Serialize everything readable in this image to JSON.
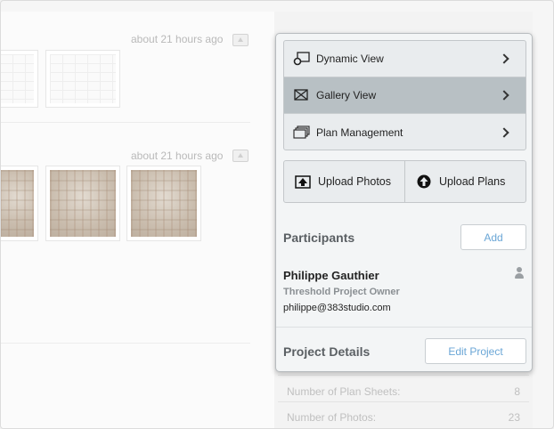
{
  "feed": {
    "items": [
      {
        "timestamp": "about 21 hours ago"
      },
      {
        "timestamp": "about 21 hours ago"
      }
    ]
  },
  "stats": {
    "rows": [
      {
        "label": "Number of Plan Sheets:",
        "value": "8"
      },
      {
        "label": "Number of Photos:",
        "value": "23"
      }
    ]
  },
  "panel": {
    "views": [
      {
        "label": "Dynamic View",
        "icon": "dynamic-view-icon",
        "selected": false
      },
      {
        "label": "Gallery View",
        "icon": "gallery-view-icon",
        "selected": true
      },
      {
        "label": "Plan Management",
        "icon": "plan-management-icon",
        "selected": false
      }
    ],
    "uploads": [
      {
        "label": "Upload Photos",
        "icon": "upload-photos-icon"
      },
      {
        "label": "Upload Plans",
        "icon": "upload-plans-icon"
      }
    ],
    "participants": {
      "title": "Participants",
      "add_label": "Add",
      "person": {
        "name": "Philippe Gauthier",
        "role": "Threshold Project Owner",
        "email": "philippe@383studio.com"
      }
    },
    "project_details": {
      "title": "Project Details",
      "edit_label": "Edit Project"
    }
  },
  "colors": {
    "accent_link": "#6aa6d6",
    "selected_row": "#b8c0c4",
    "panel_bg": "#f3f5f6"
  }
}
